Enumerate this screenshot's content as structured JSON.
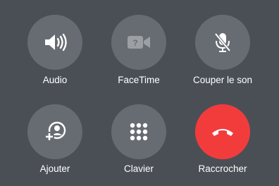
{
  "buttons": [
    {
      "label": "Audio",
      "icon": "speaker-icon",
      "state": "enabled"
    },
    {
      "label": "FaceTime",
      "icon": "facetime-icon",
      "state": "disabled"
    },
    {
      "label": "Couper le son",
      "icon": "mute-microphone-icon",
      "state": "enabled"
    },
    {
      "label": "Ajouter",
      "icon": "add-call-icon",
      "state": "enabled"
    },
    {
      "label": "Clavier",
      "icon": "keypad-icon",
      "state": "enabled"
    },
    {
      "label": "Raccrocher",
      "icon": "end-call-icon",
      "state": "enabled"
    }
  ],
  "colors": {
    "background": "#4a4f56",
    "button": "#676c73",
    "end_call": "#f23c3c",
    "icon": "#ffffff"
  }
}
